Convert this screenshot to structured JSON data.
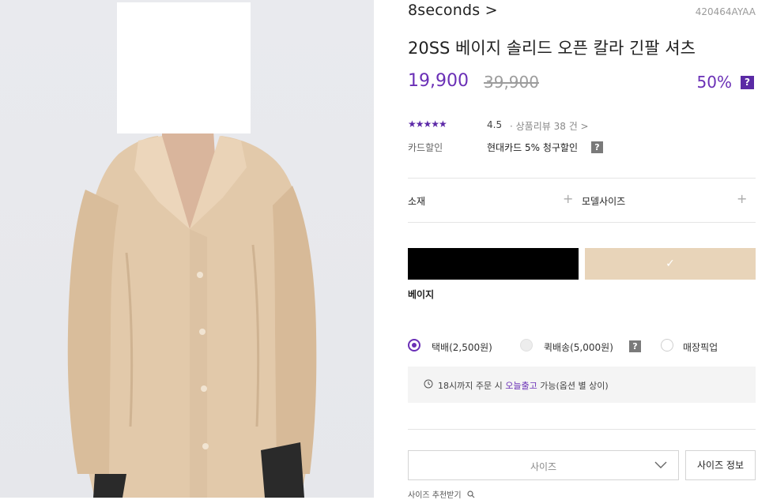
{
  "product": {
    "brand": "8seconds >",
    "sku": "420464AYAA",
    "title": "20SS 베이지 솔리드 오픈 칼라 긴팔 셔츠",
    "price": "19,900",
    "original_price": "39,900",
    "discount": "50%",
    "help_badge": "?"
  },
  "review": {
    "stars": "★★★★★",
    "rating": "4.5",
    "label": "· 상품리뷰 38 건 >"
  },
  "card": {
    "label": "카드할인",
    "value": "현대카드 5% 청구할인",
    "help_badge": "?"
  },
  "accordions": {
    "material": "소재",
    "model_size": "모델사이즈",
    "plus": "+"
  },
  "colors": {
    "selected_name": "베이지",
    "check": "✓",
    "black_hex": "#000000",
    "beige_hex": "#e8d4b9"
  },
  "shipping": {
    "options": [
      "택배(2,500원)",
      "퀵배송(5,000원)",
      "매장픽업"
    ],
    "help_badge": "?"
  },
  "notice": {
    "pre": "18시까지 주문 시 ",
    "link": "오늘출고",
    "post": " 가능(옵션 별 상이)"
  },
  "size": {
    "placeholder": "사이즈",
    "info_button": "사이즈 정보",
    "recommend": "사이즈 추천받기"
  },
  "theme": {
    "accent": "#6a2fb6",
    "text": "#222222"
  }
}
